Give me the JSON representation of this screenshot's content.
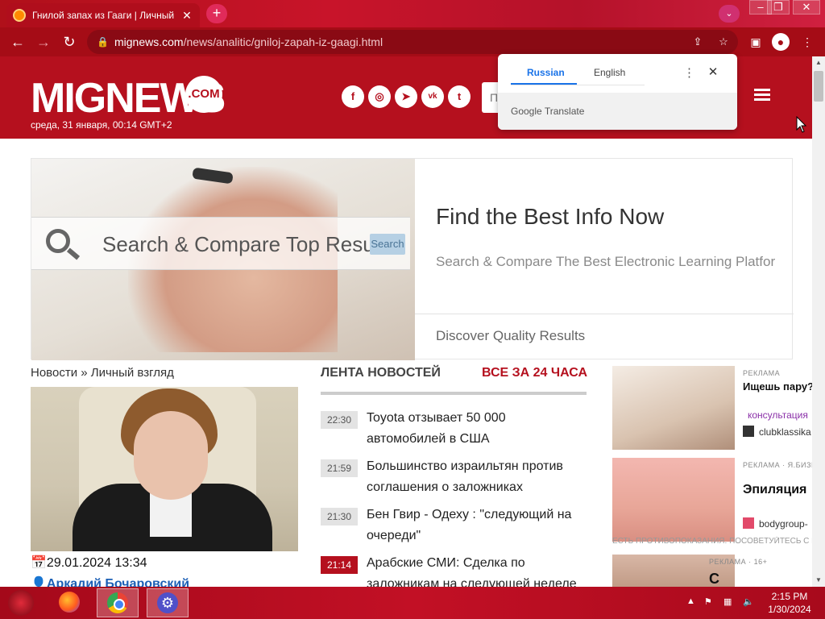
{
  "browser": {
    "tab_title": "Гнилой запах из Гааги | Личный",
    "tab_close": "✕",
    "new_tab": "+",
    "url_host": "mignews.com",
    "url_path": "/news/analitic/gniloj-zapah-iz-gaagi.html",
    "window_controls": [
      "–",
      "❐",
      "✕"
    ]
  },
  "site": {
    "logo": "MIGNEWS",
    "logo_suffix": ".COM",
    "date": "среда, 31 января, 00:14 GMT+2",
    "social": [
      "f",
      "◎",
      "➤",
      "vk",
      "t"
    ],
    "search_placeholder": "П"
  },
  "ad": {
    "image_search_text": "Search & Compare Top Results",
    "image_search_button": "Search",
    "title": "Find the Best Info Now",
    "subtitle": "Search & Compare The Best Electronic Learning Platfor",
    "discover": "Discover Quality Results"
  },
  "article": {
    "breadcrumb": "Новости » Личный взгляд",
    "date": "29.01.2024 13:34",
    "author": "Аркадий Бочаровский"
  },
  "feed": {
    "title": "ЛЕНТА НОВОСТЕЙ",
    "title2": "ВСЕ ЗА 24 ЧАСА",
    "items": [
      {
        "time": "22:30",
        "text": "Toyota отзывает 50 000 автомобилей в США"
      },
      {
        "time": "21:59",
        "text": "Большинство израильтян против соглашения о заложниках"
      },
      {
        "time": "21:30",
        "text": "Бен Гвир  - Одеху : \"следующий на очереди\""
      },
      {
        "time": "21:14",
        "text": "Арабские СМИ: Сделка по заложникам на следующей неделе"
      }
    ]
  },
  "right_ads": [
    {
      "label": "РЕКЛАМА",
      "headline": "Ищешь пару? Начни знакомиться сейчас",
      "cta": "консультация",
      "source": "clubklassika"
    },
    {
      "label": "РЕКЛАМА · Я.БИЗНЕС",
      "headline": "Эпиляция",
      "cta": "",
      "source": "bodygroup-",
      "overlay": "ЕСТЬ ПРОТИВОПОКАЗАНИЯ. ПОСОВЕТУЙТЕСЬ С ВРАЧОМ"
    },
    {
      "label": "РЕКЛАМА · 16+",
      "headline": "С",
      "cta": "",
      "source": ""
    }
  ],
  "translate_popup": {
    "tab_active": "Russian",
    "tab_other": "English",
    "brand": "Google Translate",
    "more": "⋮",
    "close": "✕"
  },
  "taskbar": {
    "time": "2:15 PM",
    "date": "1/30/2024"
  },
  "colors": {
    "brand_red": "#b5101e",
    "feed_red": "#b5101e",
    "link_blue": "#1b5fb5",
    "translate_blue": "#1a73e8"
  }
}
